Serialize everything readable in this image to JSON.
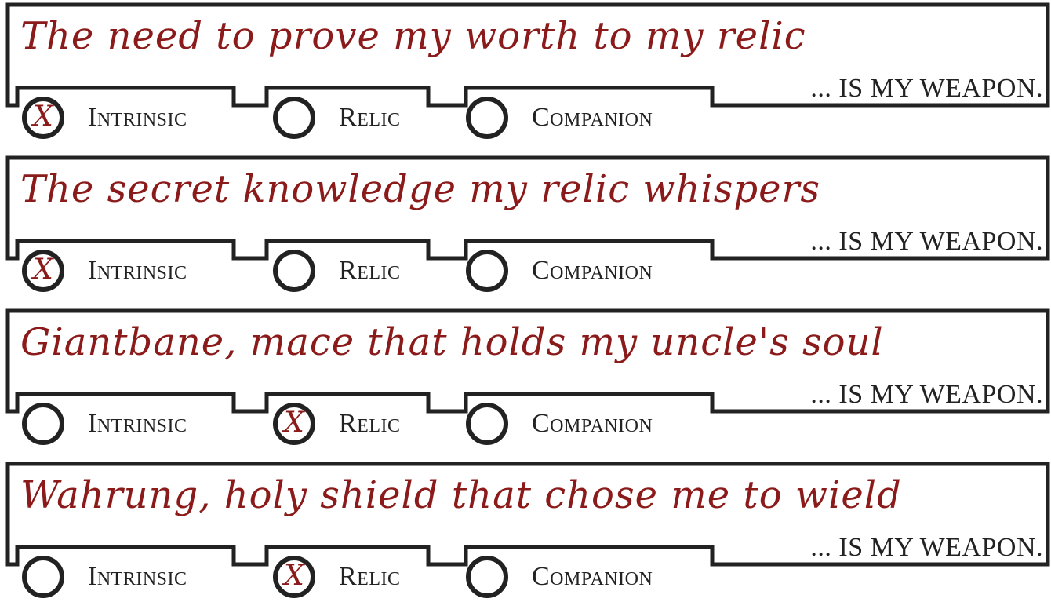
{
  "suffix": "... IS MY WEAPON.",
  "options": [
    "Intrinsic",
    "Relic",
    "Companion"
  ],
  "entries": [
    {
      "text": "The need to prove my worth to my relic",
      "selected": "Intrinsic",
      "marks": [
        "X",
        "",
        ""
      ]
    },
    {
      "text": "The secret knowledge my relic whispers",
      "selected": "Intrinsic",
      "marks": [
        "X",
        "",
        ""
      ]
    },
    {
      "text": "Giantbane, mace that holds my uncle's soul",
      "selected": "Relic",
      "marks": [
        "",
        "X",
        ""
      ]
    },
    {
      "text": "Wahrung, holy shield that chose me to wield",
      "selected": "Relic",
      "marks": [
        "",
        "X",
        ""
      ]
    }
  ],
  "colors": {
    "ink": "#222222",
    "handwriting": "#8b1a1a"
  }
}
